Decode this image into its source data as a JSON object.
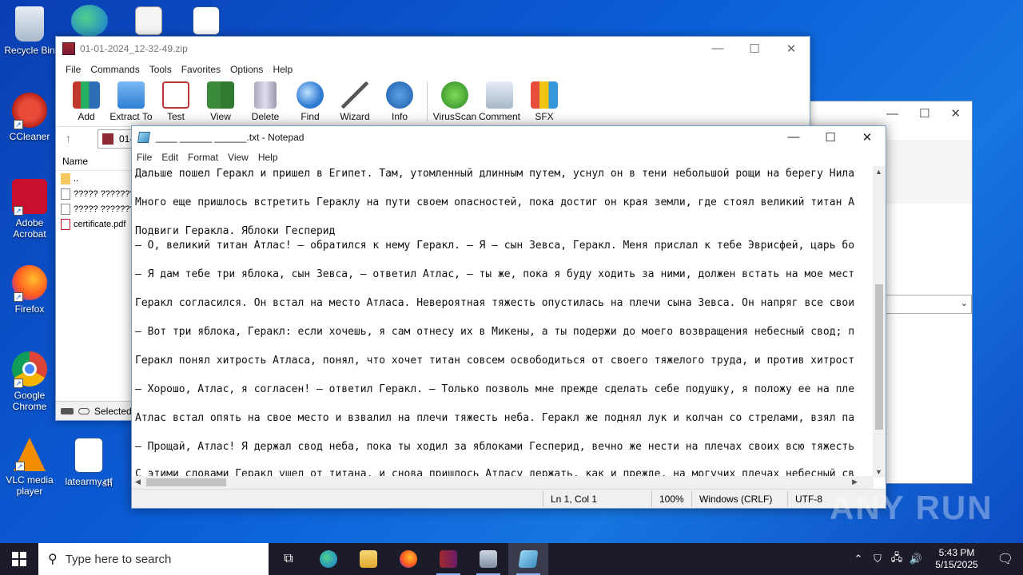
{
  "desktop": {
    "icons": [
      {
        "label": "Recycle Bin"
      },
      {
        "label": "CCleaner"
      },
      {
        "label": "Adobe Acrobat"
      },
      {
        "label": "Firefox"
      },
      {
        "label": "Google Chrome"
      },
      {
        "label": "VLC media player"
      },
      {
        "label": "latearmy.rtf"
      },
      {
        "label": "sh"
      }
    ]
  },
  "winrar": {
    "title": "01-01-2024_12-32-49.zip",
    "menu": [
      "File",
      "Commands",
      "Tools",
      "Favorites",
      "Options",
      "Help"
    ],
    "tools": [
      "Add",
      "Extract To",
      "Test",
      "View",
      "Delete",
      "Find",
      "Wizard",
      "Info",
      "VirusScan",
      "Comment",
      "SFX"
    ],
    "path": "01-",
    "column_name": "Name",
    "files": [
      "..",
      "????? ?????????",
      "????? ?????????",
      "certificate.pdf"
    ],
    "status": "Selected"
  },
  "notepad": {
    "title": "____ ______ ______.txt - Notepad",
    "menu": [
      "File",
      "Edit",
      "Format",
      "View",
      "Help"
    ],
    "lines": [
      "Дальше пошел Геракл и пришел в Египет. Там, утомленный длинным путем, уснул он в тени небольшой рощи на берегу Нила",
      "Много еще пришлось встретить Гераклу на пути своем опасностей, пока достиг он края земли, где стоял великий титан А",
      "Подвиги Геракла. Яблоки Гесперид",
      "– О, великий титан Атлас! – обратился к нему Геракл. – Я – сын Зевса, Геракл. Меня прислал к тебе Эврисфей, царь бо",
      "– Я дам тебе три яблока, сын Зевса, – ответил Атлас, – ты же, пока я буду ходить за ними, должен встать на мое мест",
      "Геракл согласился. Он встал на место Атласа. Невероятная тяжесть опустилась на плечи сына Зевса. Он напряг все свои",
      "– Вот три яблока, Геракл: если хочешь, я сам отнесу их в Микены, а ты подержи до моего возвращения небесный свод; п",
      "Геракл понял хитрость Атласа, понял, что хочет титан совсем освободиться от своего тяжелого труда, и против хитрост",
      "– Хорошо, Атлас, я согласен! – ответил Геракл. – Только позволь мне прежде сделать себе подушку, я положу ее на пле",
      "Атлас встал опять на свое место и взвалил на плечи тяжесть неба. Геракл же поднял лук и колчан со стрелами, взял па",
      "– Прощай, Атлас! Я держал свод неба, пока ты ходил за яблоками Гесперид, вечно же нести на плечах своих всю тяжесть",
      "С этими словами Геракл ушел от титана, и снова пришлось Атласу держать, как и прежде, на могучих плечах небесный св"
    ],
    "status": {
      "position": "Ln 1, Col 1",
      "zoom": "100%",
      "line_ending": "Windows (CRLF)",
      "encoding": "UTF-8"
    }
  },
  "watermark": "ANY RUN",
  "taskbar": {
    "search_placeholder": "Type here to search",
    "time": "5:43 PM",
    "date": "5/15/2025"
  }
}
